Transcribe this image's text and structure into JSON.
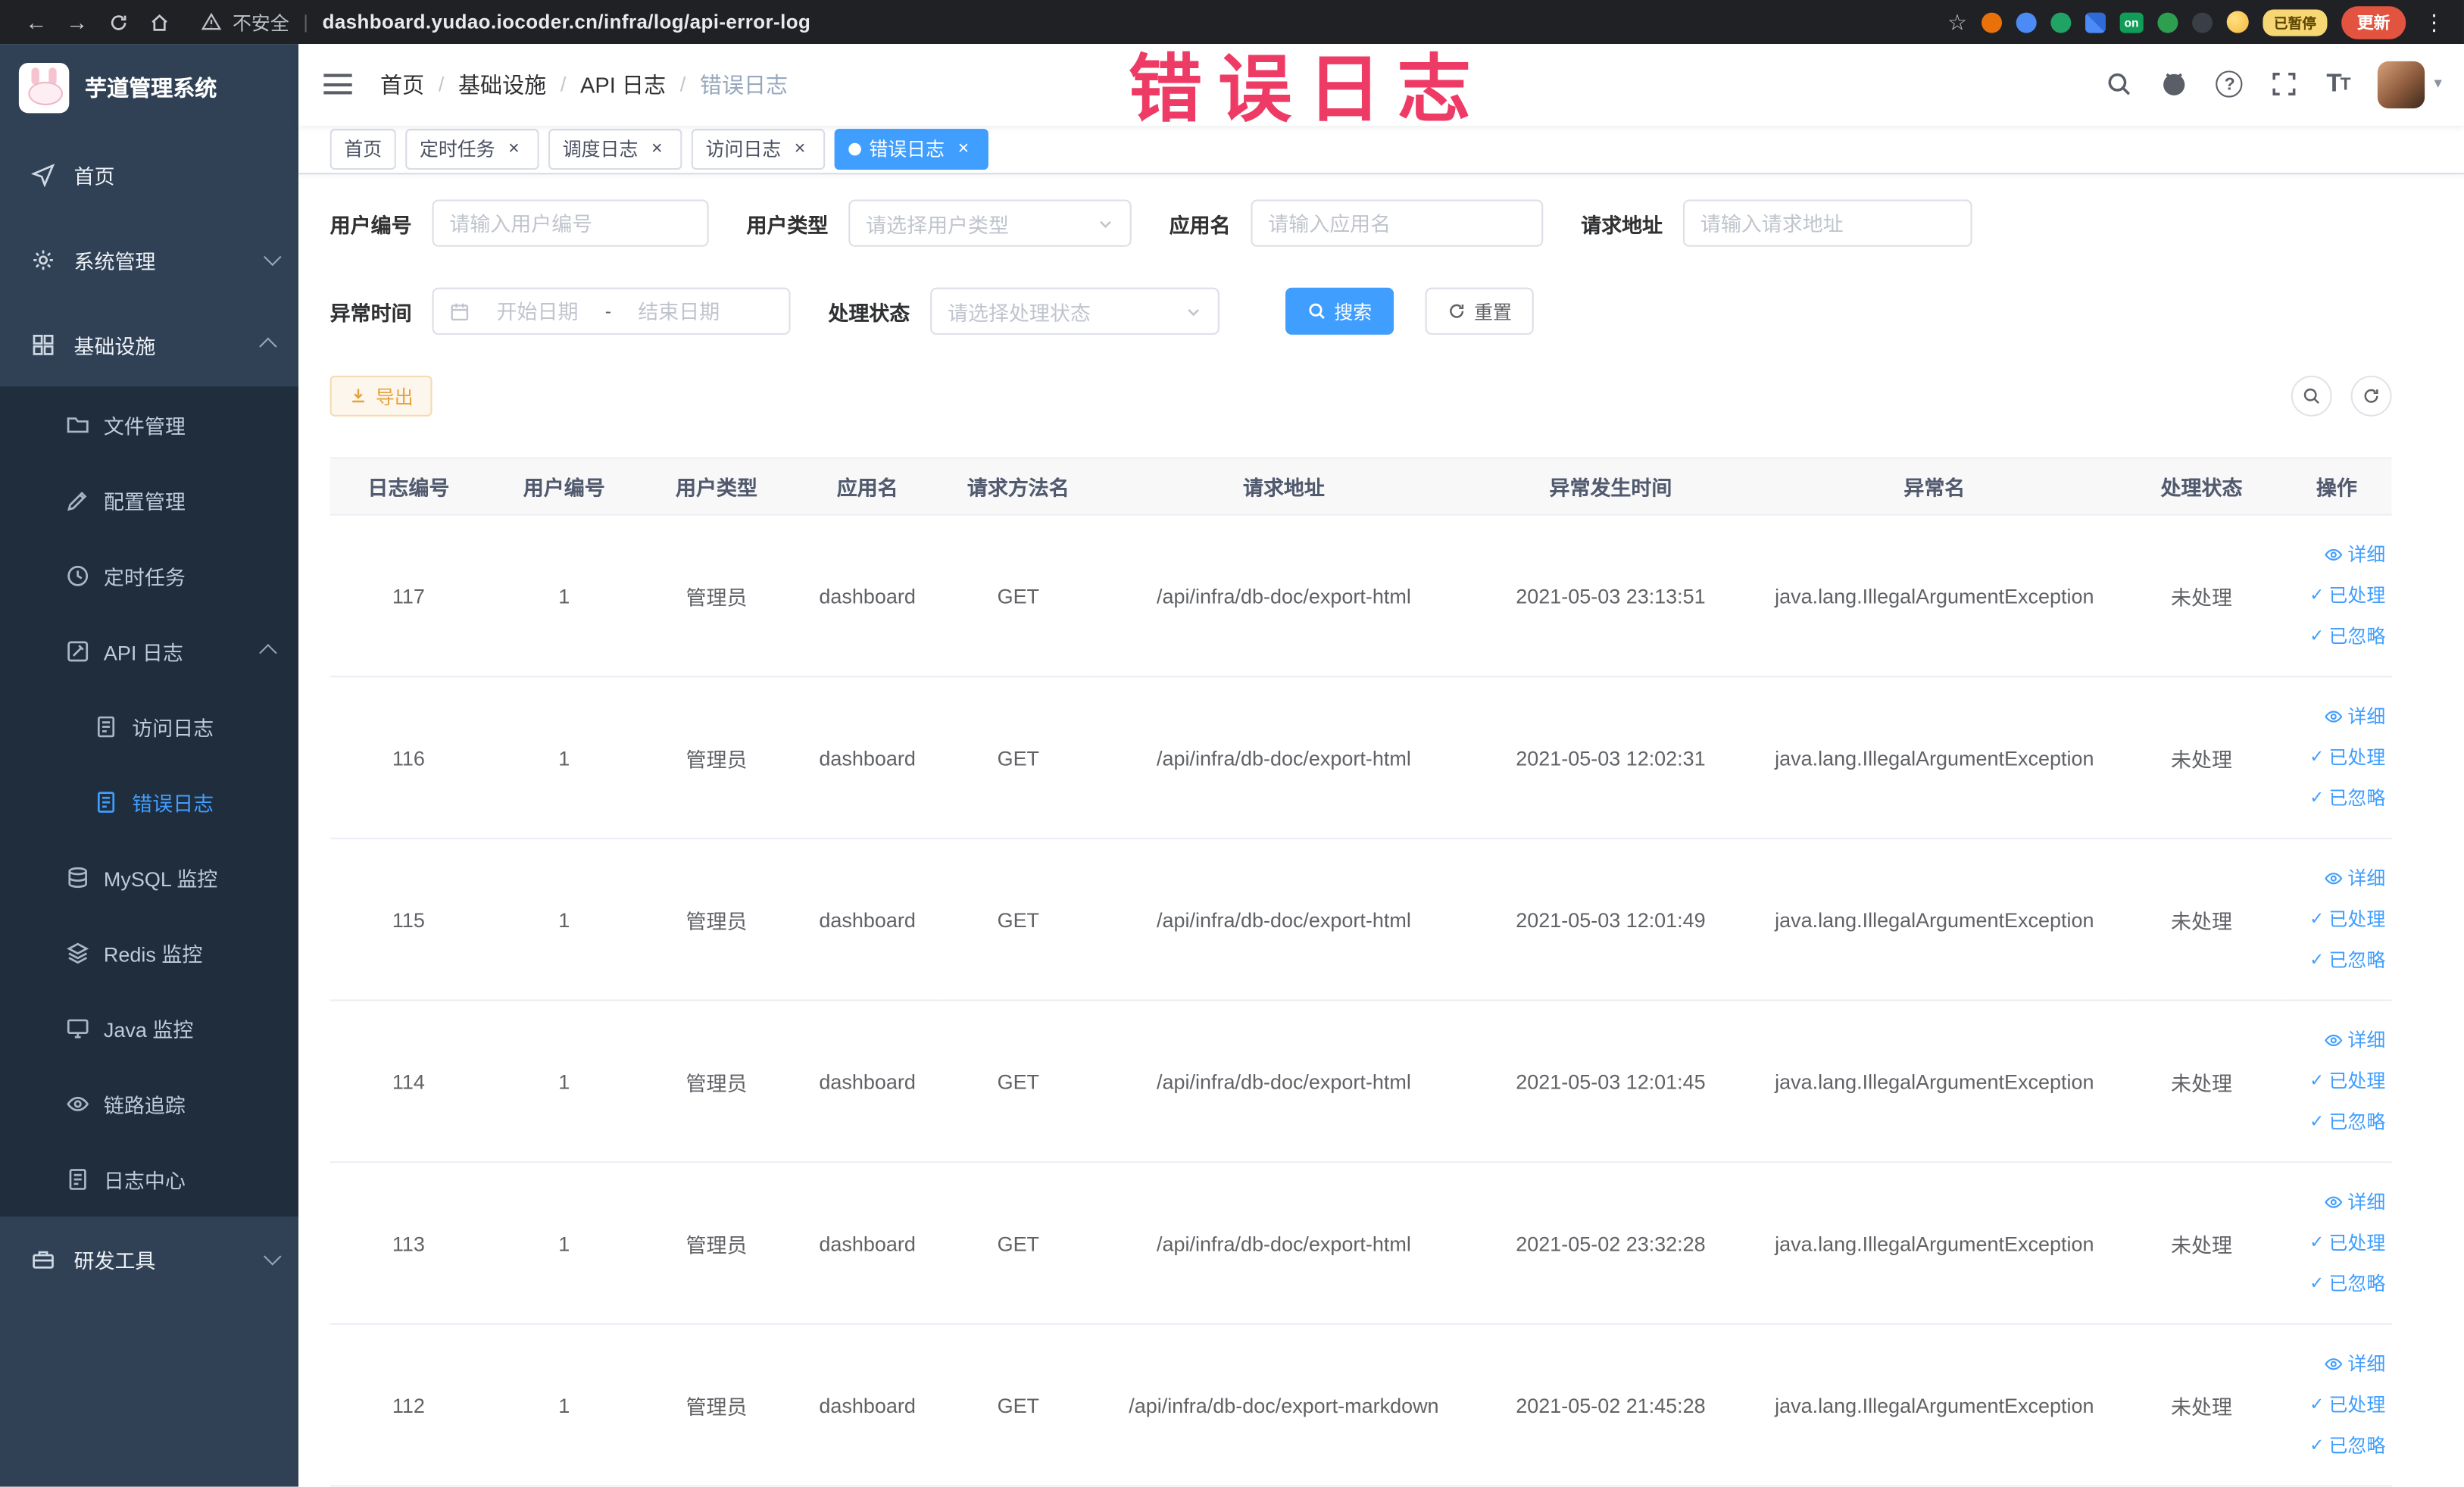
{
  "colors": {
    "accent": "#409eff",
    "watermark": "#ee3b66",
    "warning": "#e6a23c",
    "sidebar": "#304156",
    "sidebarDark": "#1f2d3d",
    "chrome": "#202124",
    "danger": "#e2543f"
  },
  "icons": {
    "back": "←",
    "forward": "→",
    "bookmark_star": "☆",
    "overflow_menu": "⋮",
    "check": "✓",
    "caret_down": "▾",
    "help": "?",
    "text_size_large": "T",
    "text_size_small": "T"
  },
  "browser": {
    "security_text": "不安全",
    "url": "dashboard.yudao.iocoder.cn/infra/log/api-error-log",
    "on_badge": "on",
    "paused_badge": "已暂停",
    "update_button": "更新"
  },
  "watermark": {
    "text": "错误日志"
  },
  "sidebar": {
    "logo_title": "芋道管理系统",
    "items": [
      {
        "label": "首页"
      },
      {
        "label": "系统管理"
      },
      {
        "label": "基础设施"
      },
      {
        "label": "文件管理"
      },
      {
        "label": "配置管理"
      },
      {
        "label": "定时任务"
      },
      {
        "label": "API 日志"
      },
      {
        "label": "访问日志"
      },
      {
        "label": "错误日志"
      },
      {
        "label": "MySQL 监控"
      },
      {
        "label": "Redis 监控"
      },
      {
        "label": "Java 监控"
      },
      {
        "label": "链路追踪"
      },
      {
        "label": "日志中心"
      },
      {
        "label": "研发工具"
      }
    ]
  },
  "header": {
    "breadcrumb": [
      "首页",
      "基础设施",
      "API 日志",
      "错误日志"
    ],
    "breadcrumb_separator": "/"
  },
  "tabs": {
    "items": [
      {
        "label": "首页"
      },
      {
        "label": "定时任务"
      },
      {
        "label": "调度日志"
      },
      {
        "label": "访问日志"
      },
      {
        "label": "错误日志"
      }
    ]
  },
  "filters": {
    "user_id": {
      "label": "用户编号",
      "placeholder": "请输入用户编号",
      "value": ""
    },
    "user_type": {
      "label": "用户类型",
      "placeholder": "请选择用户类型"
    },
    "app_name": {
      "label": "应用名",
      "placeholder": "请输入应用名",
      "value": ""
    },
    "request_url": {
      "label": "请求地址",
      "placeholder": "请输入请求地址",
      "value": ""
    },
    "exception_time": {
      "label": "异常时间",
      "start_placeholder": "开始日期",
      "separator": "-",
      "end_placeholder": "结束日期"
    },
    "process_status": {
      "label": "处理状态",
      "placeholder": "请选择处理状态"
    },
    "search_button": "搜索",
    "reset_button": "重置"
  },
  "toolbar": {
    "export_button": "导出"
  },
  "table": {
    "headers": [
      "日志编号",
      "用户编号",
      "用户类型",
      "应用名",
      "请求方法名",
      "请求地址",
      "异常发生时间",
      "异常名",
      "处理状态",
      "操作"
    ],
    "row_actions": [
      "详细",
      "已处理",
      "已忽略"
    ],
    "rows": [
      {
        "log_id": "117",
        "user_id": "1",
        "user_type": "管理员",
        "app_name": "dashboard",
        "method": "GET",
        "request_url": "/api/infra/db-doc/export-html",
        "exception_time": "2021-05-03 23:13:51",
        "exception_name": "java.lang.IllegalArgumentException",
        "status": "未处理"
      },
      {
        "log_id": "116",
        "user_id": "1",
        "user_type": "管理员",
        "app_name": "dashboard",
        "method": "GET",
        "request_url": "/api/infra/db-doc/export-html",
        "exception_time": "2021-05-03 12:02:31",
        "exception_name": "java.lang.IllegalArgumentException",
        "status": "未处理"
      },
      {
        "log_id": "115",
        "user_id": "1",
        "user_type": "管理员",
        "app_name": "dashboard",
        "method": "GET",
        "request_url": "/api/infra/db-doc/export-html",
        "exception_time": "2021-05-03 12:01:49",
        "exception_name": "java.lang.IllegalArgumentException",
        "status": "未处理"
      },
      {
        "log_id": "114",
        "user_id": "1",
        "user_type": "管理员",
        "app_name": "dashboard",
        "method": "GET",
        "request_url": "/api/infra/db-doc/export-html",
        "exception_time": "2021-05-03 12:01:45",
        "exception_name": "java.lang.IllegalArgumentException",
        "status": "未处理"
      },
      {
        "log_id": "113",
        "user_id": "1",
        "user_type": "管理员",
        "app_name": "dashboard",
        "method": "GET",
        "request_url": "/api/infra/db-doc/export-html",
        "exception_time": "2021-05-02 23:32:28",
        "exception_name": "java.lang.IllegalArgumentException",
        "status": "未处理"
      },
      {
        "log_id": "112",
        "user_id": "1",
        "user_type": "管理员",
        "app_name": "dashboard",
        "method": "GET",
        "request_url": "/api/infra/db-doc/export-markdown",
        "exception_time": "2021-05-02 21:45:28",
        "exception_name": "java.lang.IllegalArgumentException",
        "status": "未处理"
      }
    ]
  }
}
